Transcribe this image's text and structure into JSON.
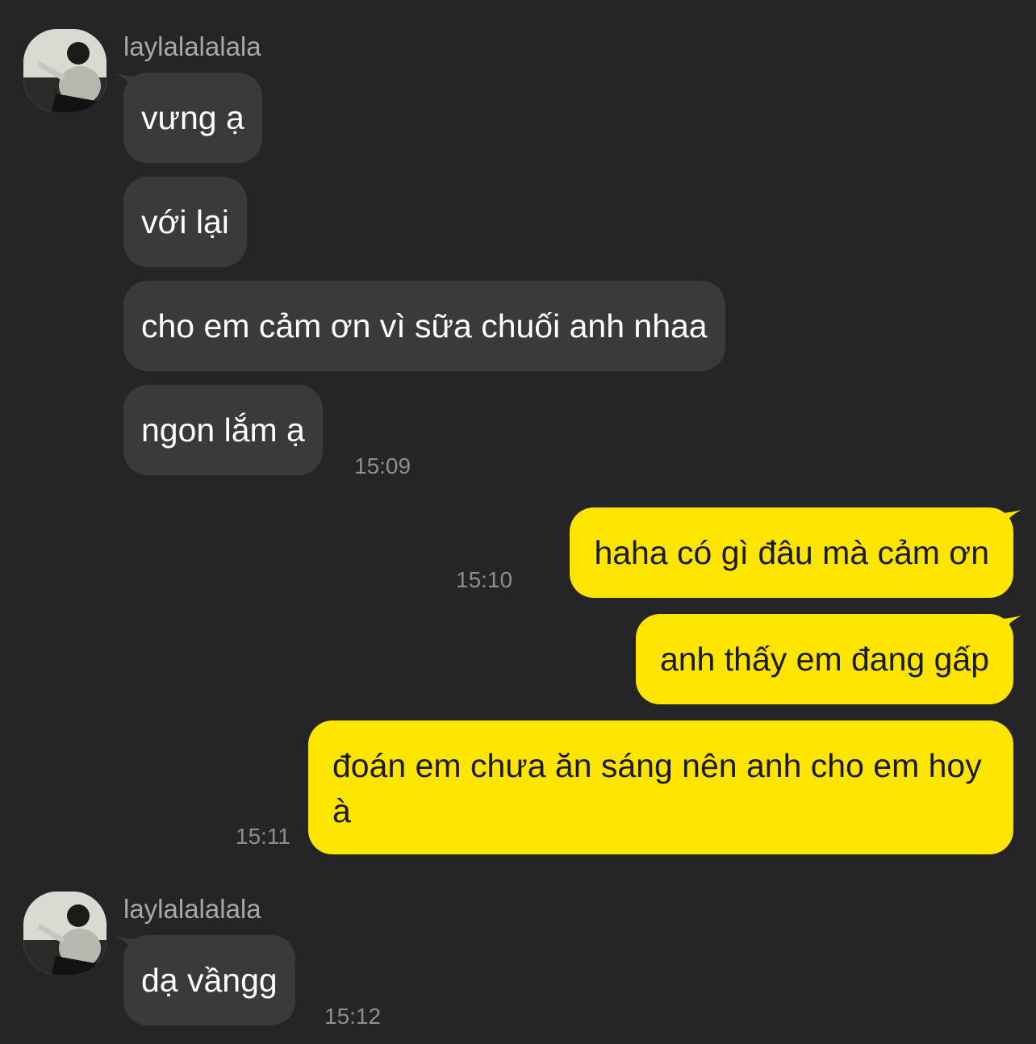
{
  "conversation": {
    "contact_name": "laylalalalala",
    "group1": {
      "sender": "laylalalalala",
      "messages": [
        "vưng ạ",
        "với lại",
        "cho em cảm ơn vì sữa chuối anh nhaa",
        "ngon lắm ạ"
      ],
      "time": "15:09"
    },
    "outgoing": [
      {
        "text": "haha có gì đâu mà cảm ơn",
        "time": "15:10"
      },
      {
        "text": "anh thấy em đang gấp",
        "time": ""
      },
      {
        "text": "đoán em chưa ăn sáng nên anh cho em hoy à",
        "time": "15:11"
      }
    ],
    "group2": {
      "sender": "laylalalalala",
      "messages": [
        "dạ vầngg"
      ],
      "time": "15:12"
    }
  },
  "colors": {
    "background": "#252527",
    "incoming_bubble": "#3a3a3c",
    "outgoing_bubble": "#fee500",
    "timestamp": "#8e8e92"
  },
  "icons": [
    "avatar-photo"
  ]
}
